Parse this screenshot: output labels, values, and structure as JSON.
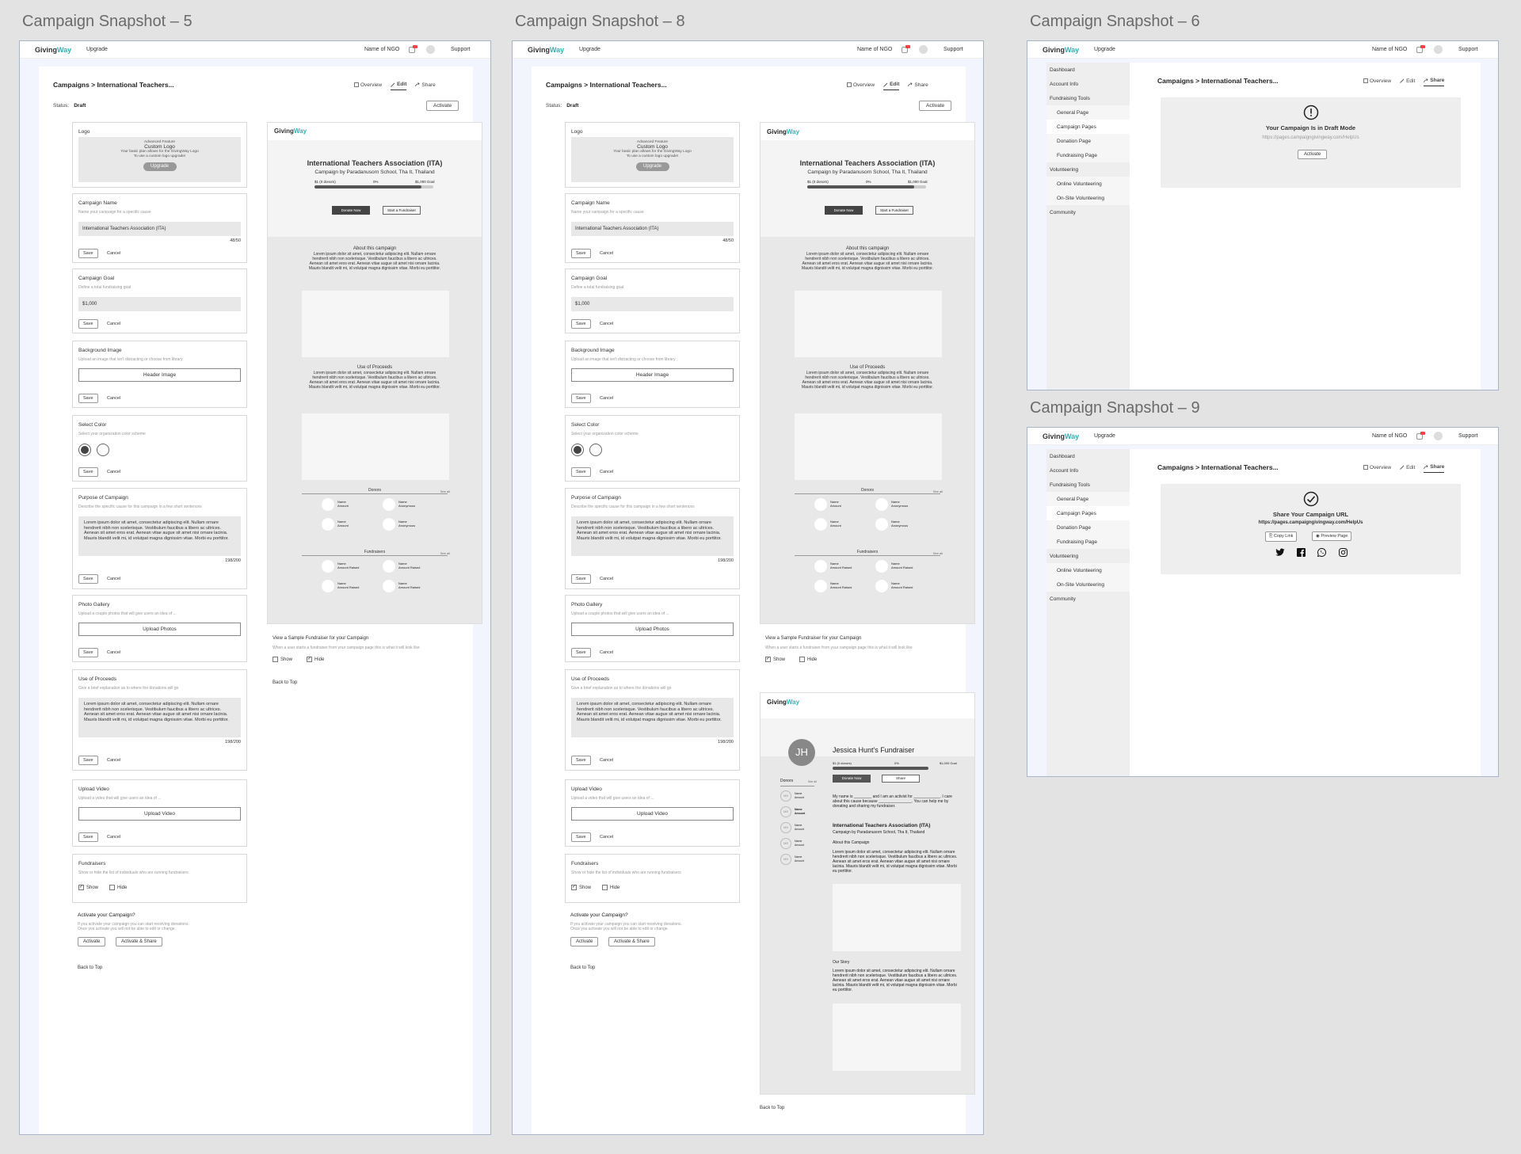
{
  "frames": [
    {
      "title": "Campaign Snapshot – 5"
    },
    {
      "title": "Campaign Snapshot – 8"
    },
    {
      "title": "Campaign Snapshot – 6"
    },
    {
      "title": "Campaign Snapshot – 9"
    }
  ],
  "nav": {
    "logo_a": "Giving",
    "logo_b": "Way",
    "upgrade": "Upgrade",
    "ngo": "Name of NGO",
    "support": "Support"
  },
  "breadcrumb": "Campaigns > International Teachers...",
  "tabs": {
    "overview": "Overview",
    "edit": "Edit",
    "share": "Share"
  },
  "status": {
    "label": "Status:",
    "value": "Draft",
    "activate": "Activate"
  },
  "form": {
    "logo": {
      "title": "Logo",
      "line1": "Advanced Feature",
      "line2": "Custom Logo",
      "line3": "Your basic plan allows for the GivingWay Logo",
      "line4": "To use a custom logo upgrade!",
      "button": "Upgrade"
    },
    "name": {
      "title": "Campaign Name",
      "desc": "Name your campaign for a specific cause",
      "value": "International Teachers Association (ITA)",
      "count": "48/50"
    },
    "goal": {
      "title": "Campaign Goal",
      "desc": "Define a total fundraising goal",
      "value": "$1,000"
    },
    "bg": {
      "title": "Background Image",
      "desc": "Upload an image that isn't distracting or choose from library",
      "button": "Header Image"
    },
    "color": {
      "title": "Select Color",
      "desc": "Select your organization color scheme"
    },
    "purpose": {
      "title": "Purpose of Campaign",
      "desc": "Describe the specific cause for this campaign in a few short sentences",
      "text": "Lorem ipsum dolor sit amet, consectetur adipiscing elit. Nullam ornare hendrerit nibh non scelerisque. Vestibulum faucibus a libero ac ultrices. Aenean sit amet eros erat. Aenean vitae augue sit amet nisi ornare lacinia. Mauris blandit velit mi, id volutpat magna dignissim vitae. Morbi eu porttitor.",
      "count": "198/200"
    },
    "gallery": {
      "title": "Photo Gallery",
      "desc": "Upload a couple photos that will give users an idea of ...",
      "button": "Upload Photos"
    },
    "proceeds": {
      "title": "Use of Proceeds",
      "desc": "Give a brief explanation as to where the donations will go",
      "text": "Lorem ipsum dolor sit amet, consectetur adipiscing elit. Nullam ornare hendrerit nibh non scelerisque. Vestibulum faucibus a libero ac ultrices. Aenean sit amet eros erat. Aenean vitae augue sit amet nisi ornare lacinia. Mauris blandit velit mi, id volutpat magna dignissim vitae. Morbi eu porttitor.",
      "count": "198/200"
    },
    "video": {
      "title": "Upload Video",
      "desc": "Upload a video that will give users an idea of ...",
      "button": "Upload Video"
    },
    "fundraisers": {
      "title": "Fundraisers",
      "desc": "Show or hide the list of individuals who are running fundraisers",
      "show": "Show",
      "hide": "Hide"
    },
    "save": "Save",
    "cancel": "Cancel",
    "activate": {
      "title": "Activate your Campaign?",
      "desc1": "If you activate your campaign you can start receiving donations.",
      "desc2": "Once you activate you will not be able to edit or change.",
      "btn1": "Activate",
      "btn2": "Activate & Share"
    },
    "back": "Back to Top"
  },
  "preview": {
    "title": "International Teachers Association (ITA)",
    "by": "Campaign by  Paradanusorn School, Tha It, Thailand",
    "raised": "$1 (0 donors)",
    "pct": "0%",
    "goal": "$1,000 Goal",
    "progress": 0.9,
    "donate": "Donate Now",
    "start": "Start a Fundraiser",
    "about": "About this campaign",
    "lorem": "Lorem ipsum dolor sit amet, consectetur adipiscing elit. Nullam ornare hendrerit nibh non scelerisque. Vestibulum faucibus a libero ac ultrices. Aenean sit amet eros erat. Aenean vitae augue sit amet nisi ornare lacinia. Mauris blandit velit mi, id volutpat magna dignissim vitae. Morbi eu porttitor.",
    "proceeds": "Use of Proceeds",
    "donors": "Donors",
    "fundraisers": "Fundraisers",
    "see_all": "See all",
    "name": "Name",
    "amount": "Amount",
    "anonymous": "Anonymous",
    "amount_raised": "Amount Raised"
  },
  "sample": {
    "title": "View a Sample Fundraiser for your Campaign",
    "desc": "When a user starts a fundraiser from your campaign page this is what it will look like",
    "show": "Show",
    "hide": "Hide"
  },
  "fund": {
    "initials": "JH",
    "name": "Jessica Hunt's Fundraiser",
    "raised": "$1 (0 donors)",
    "pct": "0%",
    "goal": "$1,000 Goal",
    "donate": "Donate Now",
    "share": "Share",
    "donors": "Donors",
    "see_all": "See all",
    "story_intro": "My name is ________ and I am an activist for ____________. I care about this cause because _______________. You can help me by donating and sharing my fundraiser.",
    "org": "International Teachers Association (ITA)",
    "by": "Campaign by  Paradanusorn School, Tha It, Thailand",
    "about": "About this Campaign",
    "story": "Our Story",
    "donor_init": "MB"
  },
  "sidebar": [
    "Dashboard",
    "Account Info",
    "Fundraising Tools",
    "General Page",
    "Campaign Pages",
    "Donation Page",
    "Fundraising Page",
    "Volunteering",
    "Online Volunteering",
    "On-Site Volunteering",
    "Community"
  ],
  "draft": {
    "title": "Your Campaign Is in Draft Mode",
    "url": "https://pages.campaigngivingway.com/HelpUs",
    "button": "Activate"
  },
  "share": {
    "title": "Share Your Campaign URL",
    "url": "https://pages.campaigngivingway.com/HelpUs",
    "copy": "Copy Link",
    "preview": "Preview Page"
  }
}
